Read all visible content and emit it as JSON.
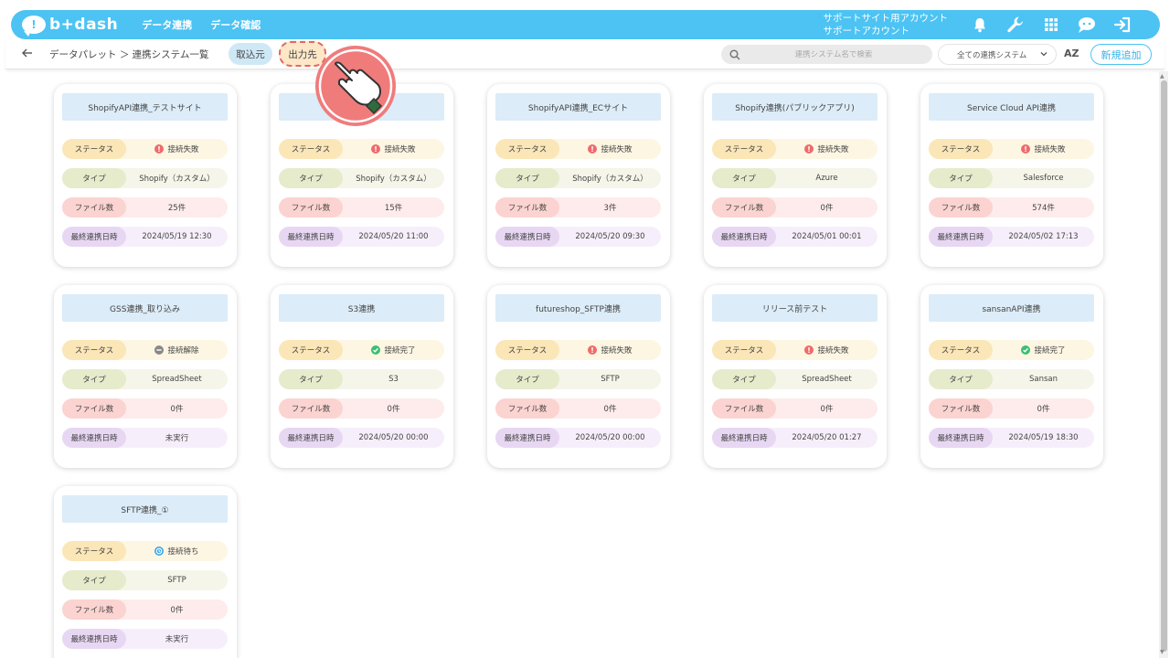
{
  "header": {
    "logo_text": "b+dash",
    "nav": [
      "データ連携",
      "データ確認"
    ],
    "account_line1": "サポートサイト用アカウント",
    "account_line2": "サポートアカウント",
    "icons": [
      "bell-icon",
      "wrench-icon",
      "grid-icon",
      "chat-bot-icon",
      "logout-icon"
    ]
  },
  "subheader": {
    "breadcrumb": "データパレット ＞ 連携システム一覧",
    "tab_import": "取込元",
    "tab_export": "出力先",
    "search_placeholder": "連携システム名で検索",
    "filter_selected": "全ての連携システム",
    "sort_label": "AZ",
    "add_button": "新規追加"
  },
  "labels": {
    "status": "ステータス",
    "type": "タイプ",
    "files": "ファイル数",
    "last_sync": "最終連携日時"
  },
  "colors": {
    "brand": "#4cc3f3",
    "error": "#ef6b6b",
    "ok": "#3cbf73",
    "disconnected": "#888888",
    "waiting": "#3aa8e6"
  },
  "cards": [
    {
      "title": "ShopifyAPI連携_テストサイト",
      "status": "接続失敗",
      "status_kind": "error",
      "type": "Shopify（カスタム）",
      "files": "25件",
      "last_sync": "2024/05/19 12:30"
    },
    {
      "title": "",
      "status": "接続失敗",
      "status_kind": "error",
      "type": "Shopify（カスタム）",
      "files": "15件",
      "last_sync": "2024/05/20 11:00"
    },
    {
      "title": "ShopifyAPI連携_ECサイト",
      "status": "接続失敗",
      "status_kind": "error",
      "type": "Shopify（カスタム）",
      "files": "3件",
      "last_sync": "2024/05/20 09:30"
    },
    {
      "title": "Shopify連携(パブリックアプリ)",
      "status": "接続失敗",
      "status_kind": "error",
      "type": "Azure",
      "files": "0件",
      "last_sync": "2024/05/01 00:01"
    },
    {
      "title": "Service Cloud API連携",
      "status": "接続失敗",
      "status_kind": "error",
      "type": "Salesforce",
      "files": "574件",
      "last_sync": "2024/05/02 17:13"
    },
    {
      "title": "GSS連携_取り込み",
      "status": "接続解除",
      "status_kind": "disconnected",
      "type": "SpreadSheet",
      "files": "0件",
      "last_sync": "未実行"
    },
    {
      "title": "S3連携",
      "status": "接続完了",
      "status_kind": "ok",
      "type": "S3",
      "files": "0件",
      "last_sync": "2024/05/20 00:00"
    },
    {
      "title": "futureshop_SFTP連携",
      "status": "接続失敗",
      "status_kind": "error",
      "type": "SFTP",
      "files": "0件",
      "last_sync": "2024/05/20 00:00"
    },
    {
      "title": "リリース前テスト",
      "status": "接続失敗",
      "status_kind": "error",
      "type": "SpreadSheet",
      "files": "0件",
      "last_sync": "2024/05/20 01:27"
    },
    {
      "title": "sansanAPI連携",
      "status": "接続完了",
      "status_kind": "ok",
      "type": "Sansan",
      "files": "0件",
      "last_sync": "2024/05/19 18:30"
    },
    {
      "title": "SFTP連携_①",
      "status": "接続待ち",
      "status_kind": "waiting",
      "type": "SFTP",
      "files": "0件",
      "last_sync": "未実行"
    }
  ]
}
